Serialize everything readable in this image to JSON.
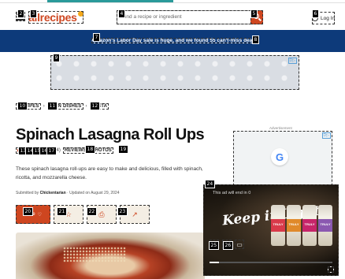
{
  "header": {
    "logo": "allrecipes",
    "search_placeholder": "Find a recipe or ingredient",
    "login_label": "Log In"
  },
  "promo": {
    "message": "Amazon's Labor Day sale is huge, and we found 55 can't-miss deals."
  },
  "ad_top": {
    "adx": "D▷"
  },
  "breadcrumb": [
    "RECIPES",
    "MAIN DISHES",
    "PASTA"
  ],
  "recipe": {
    "title": "Spinach Lasagna Roll Ups",
    "rating_count": "(104)",
    "reviews_label": "REVIEWS",
    "photos_label": "PHOTOS",
    "description": "These spinach lasagna roll-ups are easy to make and delicious, filled with spinach, ricotta, and mozzarella cheese.",
    "submitted_by_prefix": "Submitted by",
    "author": "Chickentarian",
    "updated": "Updated on August 29, 2024",
    "save_label": "Save"
  },
  "ad_right": {
    "label": "Advertisement",
    "g": "G",
    "adx": "D▷"
  },
  "video_ad": {
    "message": "This ad will end in 0",
    "slogan": "Keep it Light",
    "brand": "TRULY",
    "progress": 0.08
  },
  "badges": [
    "2",
    "3",
    "4",
    "5",
    "6",
    "7",
    "8",
    "9",
    "10",
    "11",
    "12",
    "13",
    "14",
    "15",
    "16",
    "17",
    "18",
    "19",
    "20",
    "21",
    "22",
    "23",
    "24",
    "25",
    "26"
  ],
  "colors": {
    "brand": "#ce4620",
    "promo": "#0d3a7a",
    "accent": "#f3a81b"
  }
}
